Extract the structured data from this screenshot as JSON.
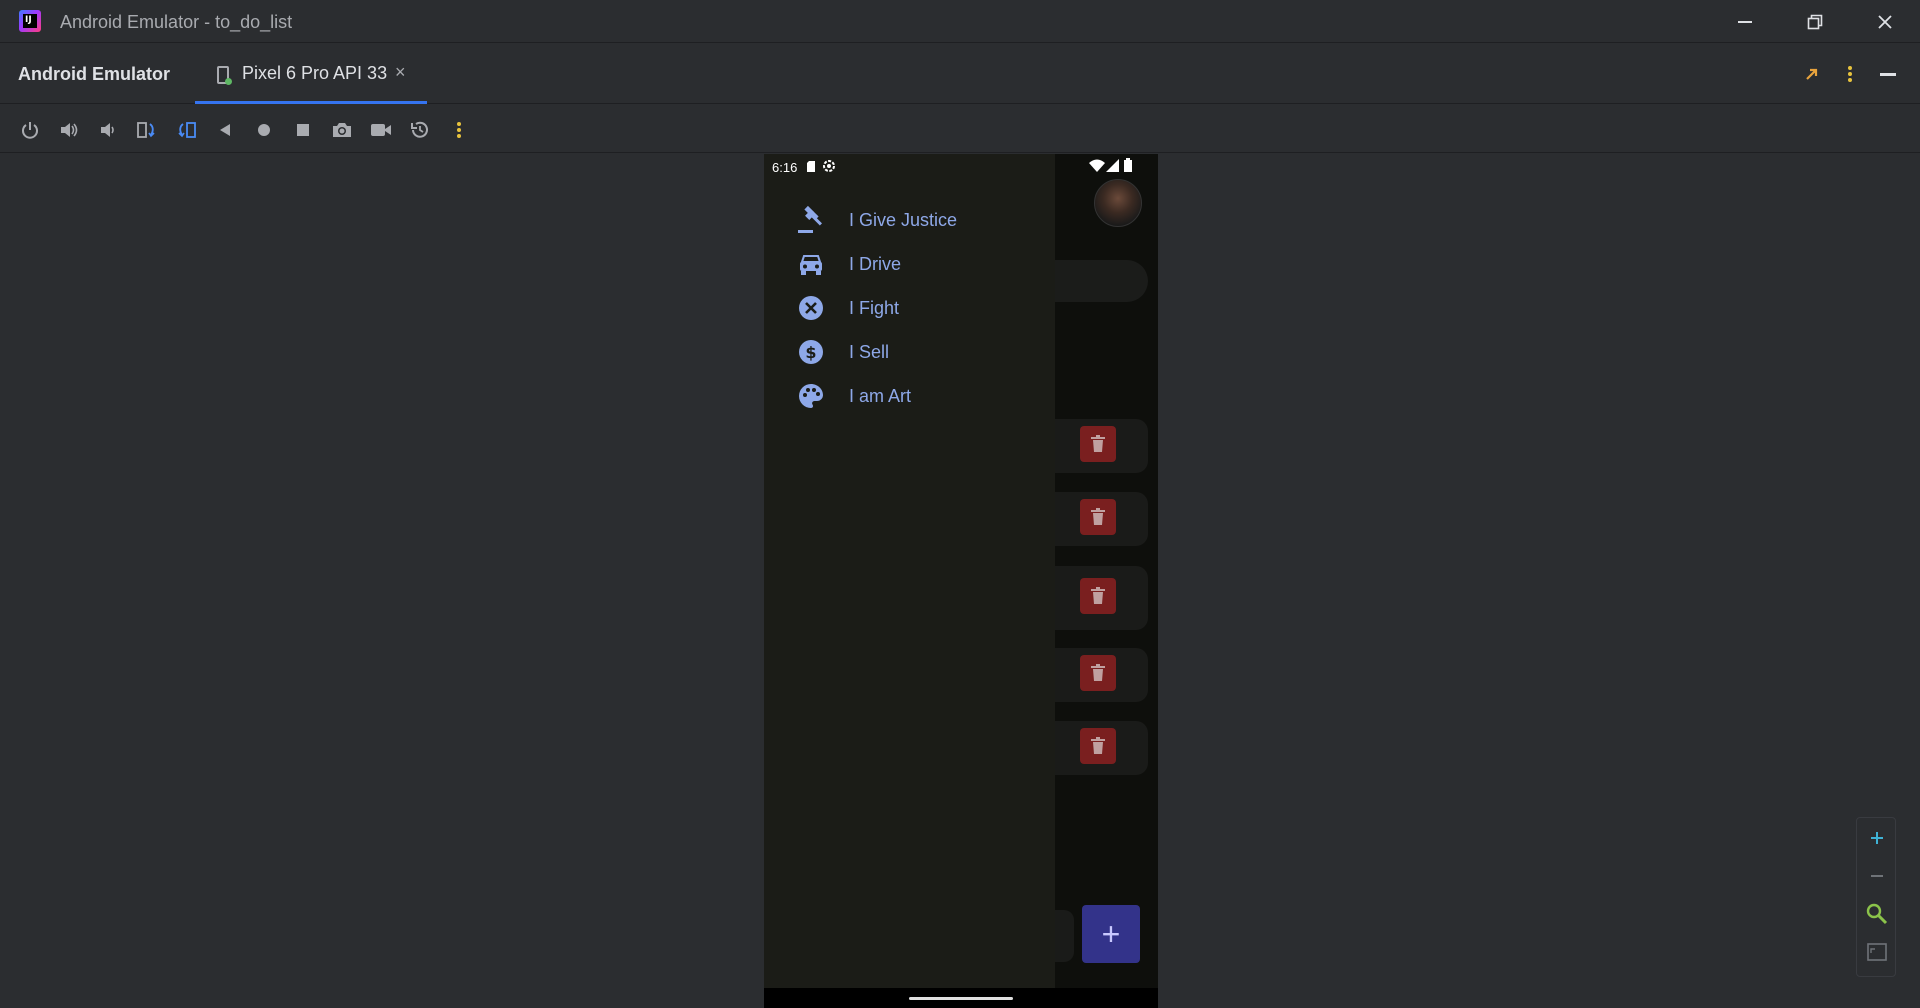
{
  "window": {
    "title": "Android Emulator - to_do_list",
    "logo_text": "IJ"
  },
  "tool_window": {
    "name": "Android Emulator",
    "device_tab": "Pixel 6 Pro API 33",
    "close_glyph": "×"
  },
  "toolbar": {
    "icons": [
      "power-icon",
      "volume-up-icon",
      "volume-down-icon",
      "rotate-left-icon",
      "rotate-right-icon",
      "back-icon",
      "home-icon",
      "overview-icon",
      "screenshot-icon",
      "screen-record-icon",
      "snapshot-icon",
      "more-icon"
    ]
  },
  "phone": {
    "status_time": "6:16",
    "drawer_items": [
      {
        "label": "I Give Justice",
        "icon": "gavel-icon"
      },
      {
        "label": "I Drive",
        "icon": "car-icon"
      },
      {
        "label": "I Fight",
        "icon": "cancel-icon"
      },
      {
        "label": "I Sell",
        "icon": "dollar-icon"
      },
      {
        "label": "I am Art",
        "icon": "palette-icon"
      }
    ],
    "fab_label": "+"
  },
  "zoom": {
    "icons": [
      "zoom-in-icon",
      "zoom-out-icon",
      "zoom-actual-icon",
      "zoom-fit-icon"
    ]
  },
  "colors": {
    "accent": "#3574f0",
    "drawer_text": "#8ea8e8",
    "fab": "#33338a",
    "trash": "#7a1f1f"
  }
}
